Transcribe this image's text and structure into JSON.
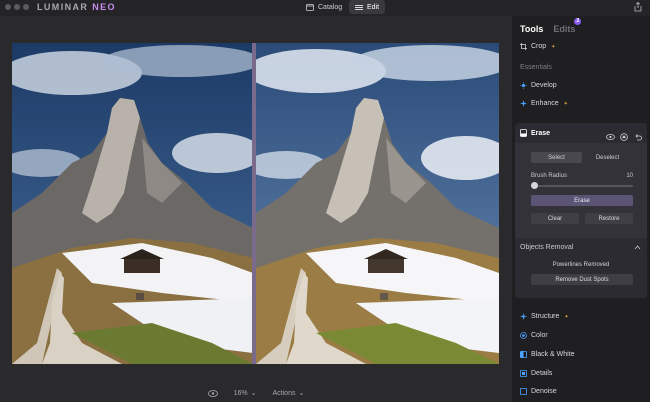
{
  "app": {
    "logo_main": "LUMINAR ",
    "logo_accent": "NEO",
    "nav_catalog": "Catalog",
    "nav_edit": "Edit"
  },
  "canvas": {
    "zoom": "16%",
    "actions": "Actions"
  },
  "panel": {
    "tab_tools": "Tools",
    "tab_edits": "Edits",
    "edits_badge": "2",
    "crop": "Crop",
    "essentials": "Essentials",
    "develop": "Develop",
    "enhance": "Enhance",
    "erase": {
      "title": "Erase",
      "select": "Select",
      "deselect": "Deselect",
      "brush_radius_label": "Brush Radius",
      "brush_radius_value": "10",
      "erase_btn": "Erase",
      "clear_btn": "Clear",
      "restore_btn": "Restore",
      "objects_removal": "Objects Removal",
      "powerlines_removed": "Powerlines Removed",
      "remove_dust_spots": "Remove Dust Spots"
    },
    "structure": "Structure",
    "color": "Color",
    "black_white": "Black & White",
    "details": "Details",
    "denoise": "Denoise"
  },
  "colors": {
    "accent": "#8a5cf0",
    "pro_badge": "#e8a33a",
    "tool_icon": "#4aa3ff"
  }
}
